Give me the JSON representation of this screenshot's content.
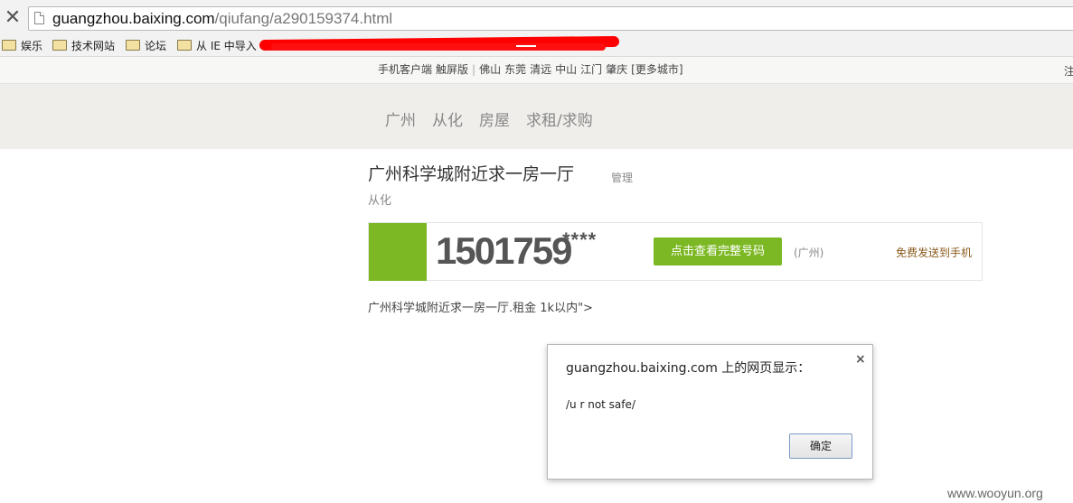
{
  "browser": {
    "close_glyph": "✕",
    "url_host": "guangzhou.baixing.com",
    "url_path": "/qiufang/a290159374.html",
    "bookmarks": [
      {
        "label": "娱乐"
      },
      {
        "label": "技术网站"
      },
      {
        "label": "论坛"
      },
      {
        "label": "从 IE 中导入"
      }
    ]
  },
  "toplinks": {
    "app": "手机客户端",
    "touch": "触屏版",
    "cities": [
      "佛山",
      "东莞",
      "清远",
      "中山",
      "江门",
      "肇庆"
    ],
    "more": "[更多城市]",
    "edge": "注"
  },
  "nav": {
    "items": [
      "广州",
      "从化",
      "房屋",
      "求租/求购"
    ]
  },
  "post": {
    "title": "广州科学城附近求一房一厅",
    "manage": "管理",
    "area": "从化",
    "phone": "1501759",
    "phone_mask": "****",
    "view_button": "点击查看完整号码",
    "region": "(广州)",
    "send_to_phone": "免费发送到手机",
    "description": "广州科学城附近求一房一厅.租金 1k以内\">"
  },
  "dialog": {
    "title": "guangzhou.baixing.com 上的网页显示：",
    "close": "×",
    "message": "/u r not safe/",
    "ok": "确定"
  },
  "watermark": "www.wooyun.org",
  "colors": {
    "accent_green": "#7cb823",
    "redaction": "#ff0000"
  }
}
